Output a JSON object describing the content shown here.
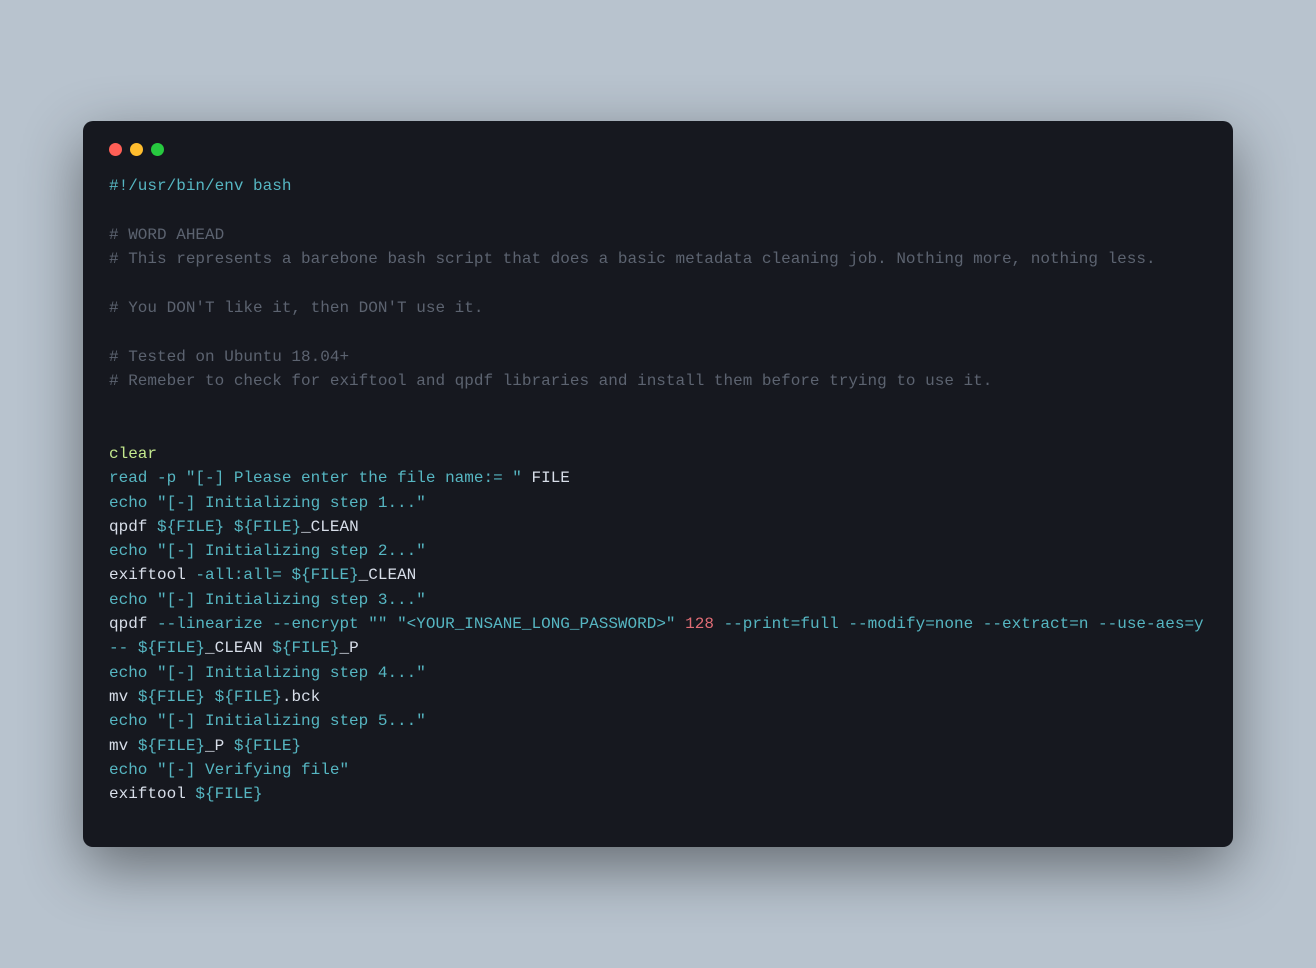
{
  "window": {
    "dots": {
      "red": "close",
      "yellow": "minimize",
      "green": "maximize"
    }
  },
  "code": {
    "shebang": "#!/usr/bin/env bash",
    "comments": {
      "c1": "# WORD AHEAD",
      "c2": "# This represents a barebone bash script that does a basic metadata cleaning job. Nothing more, nothing less.",
      "c3": "# You DON'T like it, then DON'T use it.",
      "c4": "# Tested on Ubuntu 18.04+",
      "c5": "# Remeber to check for exiftool and qpdf libraries and install them before trying to use it."
    },
    "cmds": {
      "clear": "clear",
      "read": "read",
      "read_opt": "-p",
      "read_prompt": "\"[-] Please enter the file name:= \"",
      "read_var": " FILE",
      "echo": "echo",
      "echo1": "\"[-] Initializing step 1...\"",
      "qpdf": "qpdf",
      "file_var": "${FILE}",
      "clean_suffix": "_CLEAN",
      "echo2": "\"[-] Initializing step 2...\"",
      "exiftool": "exiftool",
      "exif_opt": "-all:all=",
      "echo3": "\"[-] Initializing step 3...\"",
      "qpdf_opts1": "--linearize --encrypt",
      "empty_str": "\"\"",
      "pwd_str": "\"<YOUR_INSANE_LONG_PASSWORD>\"",
      "num128": "128",
      "qpdf_opts2": "--print=full --modify=none --extract=n --use-aes=y --",
      "p_suffix": "_P",
      "echo4": "\"[-] Initializing step 4...\"",
      "mv": "mv",
      "bck_suffix": ".bck",
      "echo5": "\"[-] Initializing step 5...\"",
      "echo6": "\"[-] Verifying file\""
    }
  }
}
